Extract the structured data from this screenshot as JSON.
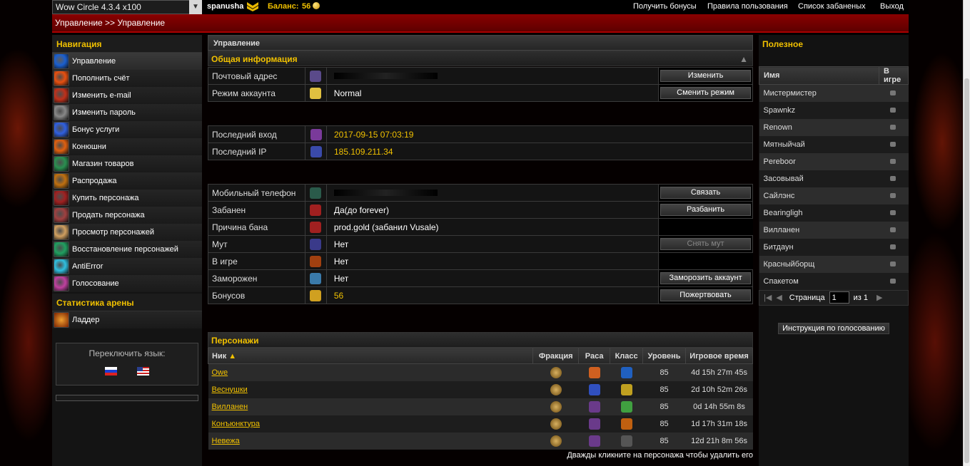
{
  "topbar": {
    "server": "Wow Circle 4.3.4 x100",
    "username": "spanusha",
    "balance_label": "Баланс:",
    "balance": "56",
    "links": [
      "Получить бонусы",
      "Правила пользования",
      "Список забаненых",
      "Выход"
    ]
  },
  "breadcrumb": "Управление >> Управление",
  "nav": {
    "title": "Навигация",
    "items": [
      "Управление",
      "Пополнить счёт",
      "Изменить e-mail",
      "Изменить пароль",
      "Бонус услуги",
      "Конюшни",
      "Магазин товаров",
      "Распродажа",
      "Купить персонажа",
      "Продать персонажа",
      "Просмотр персонажей",
      "Восстановление персонажей",
      "AntiError",
      "Голосование"
    ],
    "arena_title": "Статистика арены",
    "arena_items": [
      "Ладдер"
    ],
    "lang_title": "Переключить язык:"
  },
  "icons": [
    "icon-manage",
    "icon-refill",
    "icon-email",
    "icon-password",
    "icon-bonus",
    "icon-stable",
    "icon-shop",
    "icon-sale",
    "icon-buy-char",
    "icon-sell-char",
    "icon-view-chars",
    "icon-restore",
    "icon-antierror",
    "icon-vote"
  ],
  "center": {
    "title": "Управление",
    "info_title": "Общая информация",
    "rows1": [
      {
        "label": "Почтовый адрес",
        "value": "",
        "button": "Изменить"
      },
      {
        "label": "Режим аккаунта",
        "value": "Normal",
        "button": "Сменить режим"
      }
    ],
    "rows2": [
      {
        "label": "Последний вход",
        "value": "2017-09-15 07:03:19"
      },
      {
        "label": "Последний IP",
        "value": "185.109.211.34"
      }
    ],
    "rows3": [
      {
        "label": "Мобильный телефон",
        "value": "",
        "button": "Связать"
      },
      {
        "label": "Забанен",
        "value": "Да(до forever)",
        "button": "Разбанить"
      },
      {
        "label": "Причина бана",
        "value": "prod.gold (забанил Vusale)",
        "button": ""
      },
      {
        "label": "Мут",
        "value": "Нет",
        "button": "Снять мут"
      },
      {
        "label": "В игре",
        "value": "Нет",
        "button": ""
      },
      {
        "label": "Заморожен",
        "value": "Нет",
        "button": "Заморозить аккаунт"
      },
      {
        "label": "Бонусов",
        "value": "56",
        "button": "Пожертвовать"
      }
    ],
    "chars_title": "Персонажи",
    "chars_headers": [
      "Ник",
      "Фракция",
      "Раса",
      "Класс",
      "Уровень",
      "Игровое время"
    ],
    "chars": [
      {
        "name": "Owe",
        "level": "85",
        "time": "4d 15h 27m 45s"
      },
      {
        "name": "Веснушки",
        "level": "85",
        "time": "2d 10h 52m 26s"
      },
      {
        "name": "Вилланен",
        "level": "85",
        "time": "0d 14h 55m 8s"
      },
      {
        "name": "Конъюнктура",
        "level": "85",
        "time": "1d 17h 31m 18s"
      },
      {
        "name": "Невежа",
        "level": "85",
        "time": "12d 21h 8m 56s"
      }
    ],
    "footer_hint": "Дважды кликните на персонажа чтобы удалить его"
  },
  "right": {
    "title": "Полезное",
    "col_name": "Имя",
    "col_ingame": "В игре",
    "players": [
      "Мистермистер",
      "Spawnkz",
      "Renown",
      "Мятныйчай",
      "Pereboor",
      "Засовывай",
      "Сайлэнс",
      "Bearingligh",
      "Вилланен",
      "Битдаун",
      "Красныйборщ",
      "Спакетом"
    ],
    "page_label": "Страница",
    "page": "1",
    "of_label": "из 1",
    "vote_button": "Инструкция по голосованию"
  },
  "colors": {
    "accent": "#f0c000",
    "header_red": "#7a0000"
  }
}
